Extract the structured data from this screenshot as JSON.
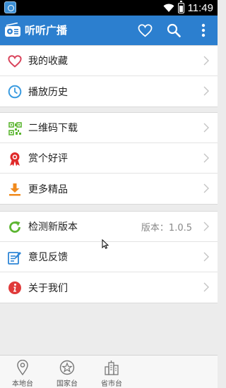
{
  "status": {
    "time": "11:49"
  },
  "app": {
    "title": "听听广播"
  },
  "groups": [
    {
      "items": [
        {
          "label": "我的收藏",
          "icon": "heart-icon"
        },
        {
          "label": "播放历史",
          "icon": "clock-icon"
        }
      ]
    },
    {
      "items": [
        {
          "label": "二维码下载",
          "icon": "qr-code-icon"
        },
        {
          "label": "赏个好评",
          "icon": "award-ribbon-icon"
        },
        {
          "label": "更多精品",
          "icon": "download-icon"
        }
      ]
    },
    {
      "items": [
        {
          "label": "检测新版本",
          "icon": "refresh-icon",
          "value": "版本：1.0.5"
        },
        {
          "label": "意见反馈",
          "icon": "feedback-edit-icon"
        },
        {
          "label": "关于我们",
          "icon": "info-icon"
        }
      ]
    }
  ],
  "tabs": [
    {
      "label": "本地台",
      "icon": "location-pin-icon"
    },
    {
      "label": "国家台",
      "icon": "star-badge-icon"
    },
    {
      "label": "省市台",
      "icon": "city-buildings-icon"
    }
  ],
  "colors": {
    "header": "#2c7fcf",
    "background": "#ececec",
    "heart": "#d9425a",
    "clock": "#3a9be0",
    "qr": "#5cb531",
    "award": "#e02a2a",
    "download": "#f08a1d",
    "refresh": "#5cb531",
    "feedback": "#2f86d6",
    "info": "#e03a3a"
  }
}
